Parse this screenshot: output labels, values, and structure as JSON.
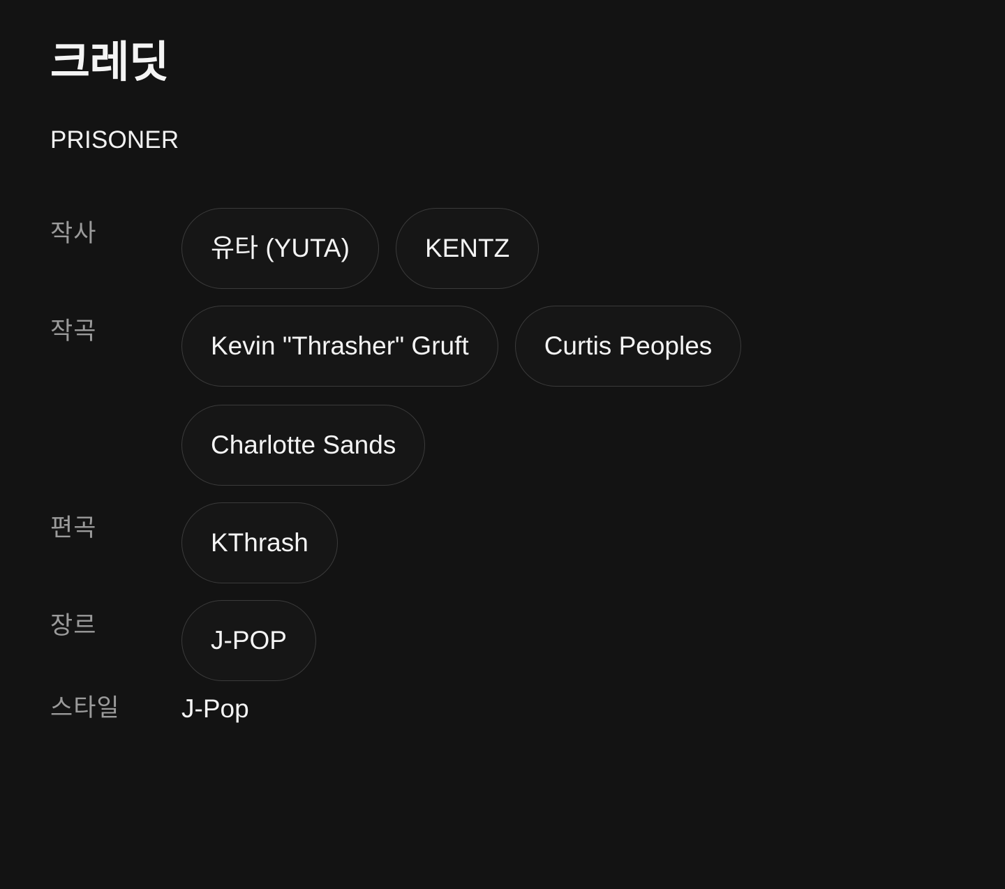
{
  "page": {
    "title": "크레딧",
    "track_name": "PRISONER",
    "background_color": "#131313",
    "text_color": "#f4f4f4",
    "label_color": "#9b9b9b",
    "chip_border_color": "#3b3b3b"
  },
  "credits": [
    {
      "label": "작사",
      "type": "chips",
      "values": [
        "유타 (YUTA)",
        "KENTZ"
      ]
    },
    {
      "label": "작곡",
      "type": "chips",
      "values": [
        "Kevin \"Thrasher\" Gruft",
        "Curtis Peoples",
        "Charlotte Sands"
      ]
    },
    {
      "label": "편곡",
      "type": "chips",
      "values": [
        "KThrash"
      ]
    },
    {
      "label": "장르",
      "type": "chips",
      "values": [
        "J-POP"
      ]
    },
    {
      "label": "스타일",
      "type": "text",
      "values": [
        "J-Pop"
      ]
    }
  ]
}
